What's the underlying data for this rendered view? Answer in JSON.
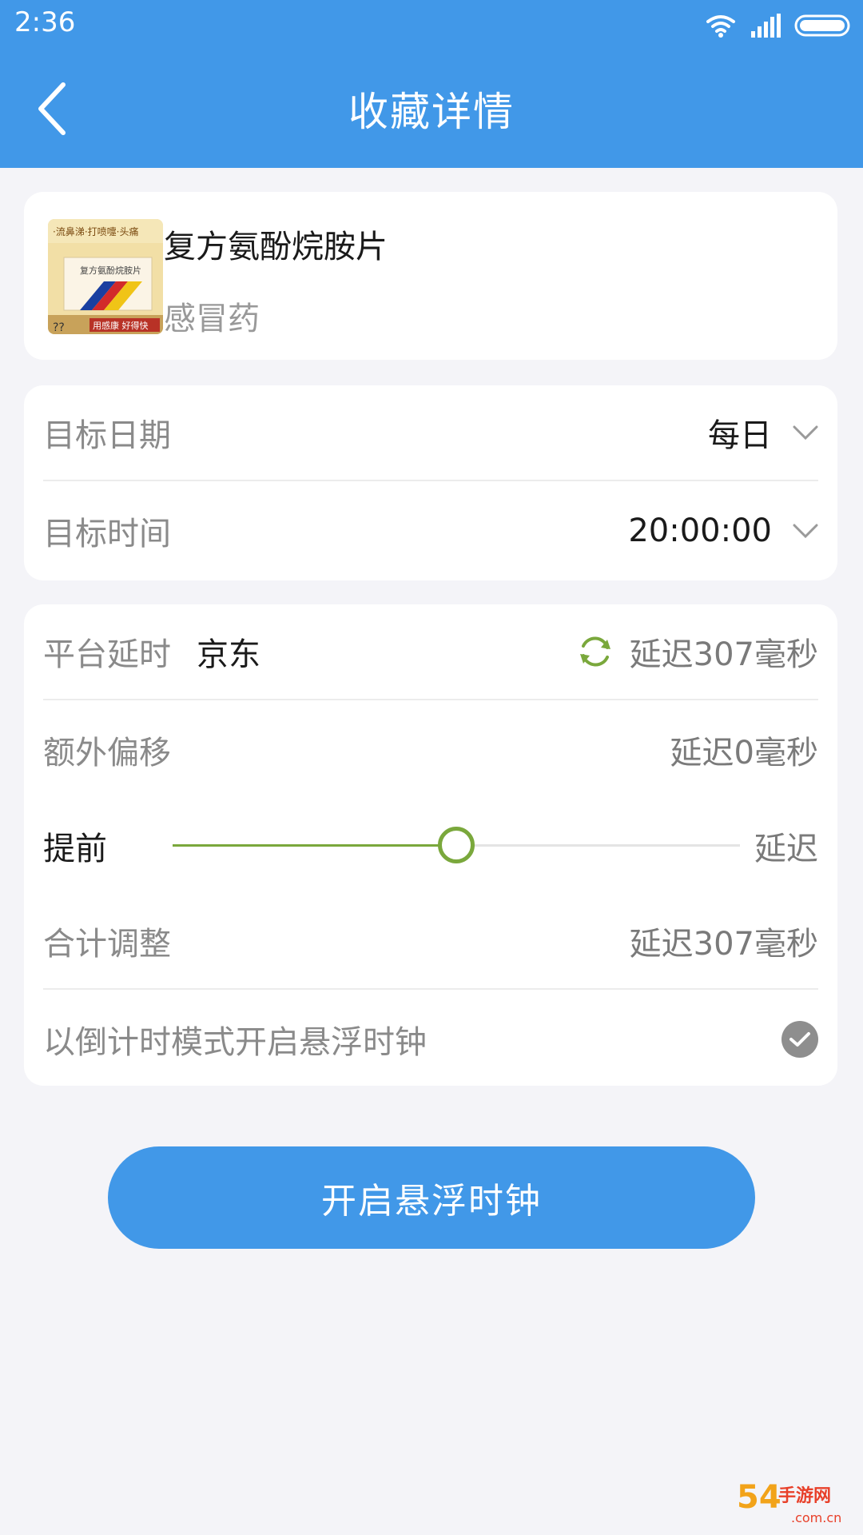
{
  "status_bar": {
    "time": "2:36"
  },
  "header": {
    "title": "收藏详情"
  },
  "product": {
    "name": "复方氨酚烷胺片",
    "category": "感冒药",
    "thumb_top_text": "·流鼻涕·打喷嚏·头痛",
    "thumb_box_text": "复方氨酚烷胺片",
    "thumb_bottom_text": "用感康 好得快"
  },
  "target": {
    "date_label": "目标日期",
    "date_value": "每日",
    "time_label": "目标时间",
    "time_value": "20:00:00"
  },
  "platform": {
    "label": "平台延时",
    "name": "京东",
    "delay": "延迟307毫秒",
    "extra_label": "额外偏移",
    "extra_value": "延迟0毫秒",
    "slider_left": "提前",
    "slider_right": "延迟",
    "slider_position": 0.5,
    "total_label": "合计调整",
    "total_value": "延迟307毫秒",
    "countdown_label": "以倒计时模式开启悬浮时钟",
    "countdown_checked": true
  },
  "action": {
    "button_label": "开启悬浮时钟"
  },
  "watermark": {
    "text": "54手游网",
    "sub": ".com.cn"
  },
  "colors": {
    "primary": "#4198e8",
    "accent_green": "#7aa83c",
    "background": "#f4f4f8"
  }
}
